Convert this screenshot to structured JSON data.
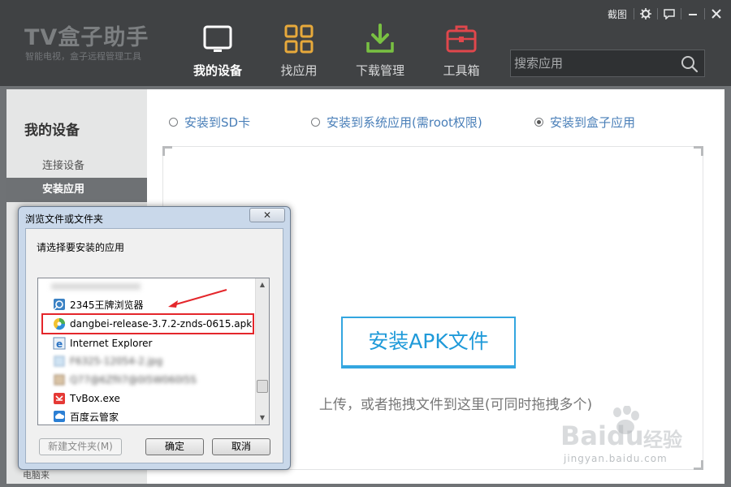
{
  "app": {
    "brand_title": "TV盒子助手",
    "brand_subtitle": "智能电视，盒子远程管理工具"
  },
  "header": {
    "nav": [
      {
        "label": "我的设备",
        "icon": "tv-icon",
        "active": true
      },
      {
        "label": "找应用",
        "icon": "grid-icon",
        "active": false
      },
      {
        "label": "下载管理",
        "icon": "download-icon",
        "active": false
      },
      {
        "label": "工具箱",
        "icon": "toolbox-icon",
        "active": false
      }
    ],
    "search": {
      "placeholder": "搜索应用",
      "icon": "search-icon"
    },
    "tools": {
      "screenshot_label": "截图",
      "settings_icon": "gear-icon",
      "feedback_icon": "chat-icon",
      "minimize_icon": "minimize-icon",
      "close_icon": "close-icon"
    }
  },
  "sidebar": {
    "title": "我的设备",
    "items": [
      {
        "label": "连接设备",
        "active": false
      },
      {
        "label": "安装应用",
        "active": true
      }
    ],
    "partial_label": "电脑来"
  },
  "main": {
    "install_options": [
      {
        "label": "安装到SD卡",
        "checked": false
      },
      {
        "label": "安装到系统应用(需root权限)",
        "checked": false
      },
      {
        "label": "安装到盒子应用",
        "checked": true
      }
    ],
    "install_button": "安装APK文件",
    "drop_hint": "上传，或者拖拽文件到这里(可同时拖拽多个)"
  },
  "dialog": {
    "title": "浏览文件或文件夹",
    "close_label": "✕",
    "prompt": "请选择要安装的应用",
    "items": [
      {
        "label": "2345王牌浏览器",
        "icon": "browser-shortcut-icon",
        "selected": false,
        "blurred": false
      },
      {
        "label": "dangbei-release-3.7.2-znds-0615.apk",
        "icon": "apk-icon",
        "selected": true,
        "blurred": false
      },
      {
        "label": "Internet Explorer",
        "icon": "ie-icon",
        "selected": false,
        "blurred": false
      },
      {
        "label": "F6325-12054-2.jpg",
        "icon": "image-file-icon",
        "selected": false,
        "blurred": true
      },
      {
        "label": "Q77@6ZfII7@0I5W060I5S",
        "icon": "file-icon",
        "selected": false,
        "blurred": true
      },
      {
        "label": "TvBox.exe",
        "icon": "tvbox-icon",
        "selected": false,
        "blurred": false
      },
      {
        "label": "百度云管家",
        "icon": "baidu-cloud-icon",
        "selected": false,
        "blurred": false
      }
    ],
    "buttons": {
      "new_folder": "新建文件夹(M)",
      "ok": "确定",
      "cancel": "取消"
    }
  },
  "watermark": {
    "brand": "Bai",
    "brand2": "du",
    "cn": "经验",
    "url": "jingyan.baidu.com"
  },
  "colors": {
    "header_bg": "#404244",
    "accent_blue": "#1f9ad9",
    "highlight_red": "#e4262b"
  }
}
